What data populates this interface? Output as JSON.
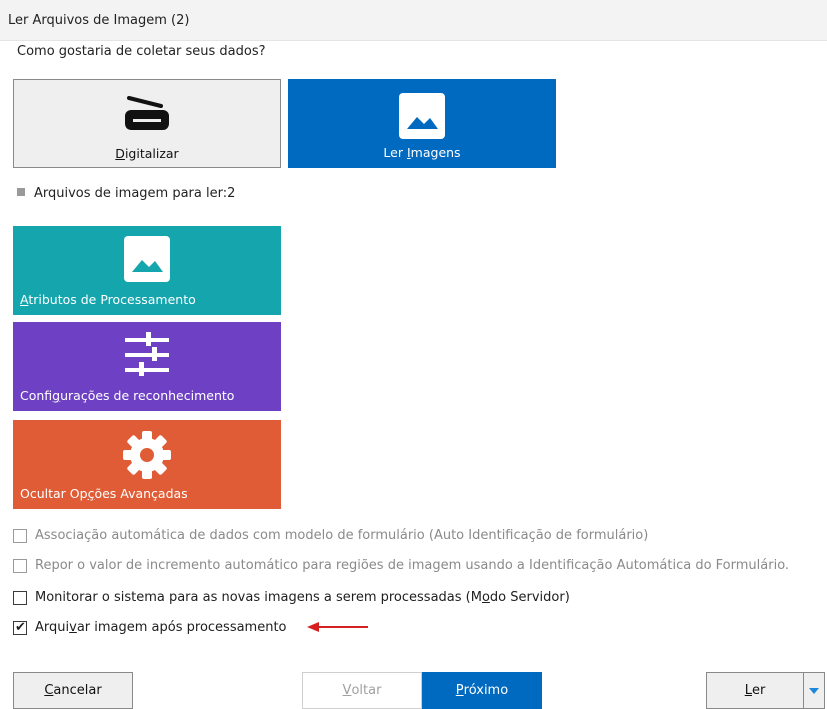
{
  "window": {
    "title": "Ler Arquivos de Imagem (2)"
  },
  "prompt": "Como gostaria de coletar seus dados?",
  "sources": {
    "scan": {
      "pre": "",
      "key": "D",
      "post": "igitalizar",
      "icon": "scanner-icon"
    },
    "read_images": {
      "pre": "Ler ",
      "key": "I",
      "post": "magens",
      "icon": "image-icon",
      "selected": true
    }
  },
  "files_to_read": "Arquivos de imagem para ler:2",
  "tiles": {
    "processing": {
      "pre": "",
      "key": "A",
      "post": "tributos de Processamento",
      "color": "#14a5ad",
      "icon": "image-icon"
    },
    "recognition": {
      "pre": "Confi",
      "key": "g",
      "post": "urações de reconhecimento",
      "color": "#6e40c4",
      "icon": "sliders-icon"
    },
    "advanced": {
      "pre": "Ocultar Op",
      "key": "ç",
      "post": "ões Avançadas",
      "color": "#e05c36",
      "icon": "gear-icon"
    }
  },
  "options": [
    {
      "pre": "Associação automática de dados com modelo de formulário (Auto Identificação de formulário)",
      "key": "",
      "post": "",
      "checked": false,
      "enabled": false
    },
    {
      "pre": "Repor o valor de incremento automático para regiões de imagem usando a Identificação Automática do Formulário.",
      "key": "",
      "post": "",
      "checked": false,
      "enabled": false
    },
    {
      "pre": "Monitorar o sistema para as novas imagens a serem processadas (M",
      "key": "o",
      "post": "do Servidor)",
      "checked": false,
      "enabled": true
    },
    {
      "pre": "Arqui",
      "key": "v",
      "post": "ar imagem após processamento",
      "checked": true,
      "enabled": true
    }
  ],
  "buttons": {
    "cancel": {
      "pre": "",
      "key": "C",
      "post": "ancelar"
    },
    "back": {
      "pre": "",
      "key": "V",
      "post": "oltar",
      "enabled": false
    },
    "next": {
      "pre": "",
      "key": "P",
      "post": "róximo"
    },
    "read": {
      "pre": "",
      "key": "L",
      "post": "er"
    }
  },
  "colors": {
    "accent": "#0069c0",
    "annotation_arrow": "#d42020"
  }
}
